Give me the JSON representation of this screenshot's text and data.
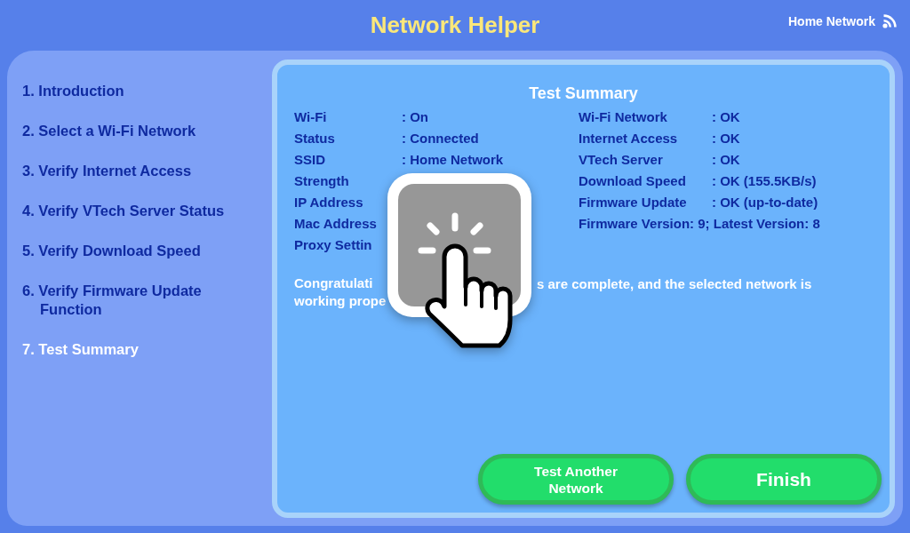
{
  "header": {
    "title": "Network Helper",
    "network_name": "Home Network"
  },
  "steps": [
    {
      "label": "1. Introduction",
      "selected": false
    },
    {
      "label": "2. Select a Wi-Fi Network",
      "selected": false
    },
    {
      "label": "3. Verify Internet Access",
      "selected": false
    },
    {
      "label": "4. Verify VTech Server Status",
      "selected": false
    },
    {
      "label": "5. Verify Download Speed",
      "selected": false
    },
    {
      "label": "6. Verify Firmware Update Function",
      "selected": false
    },
    {
      "label": "7. Test Summary",
      "selected": true
    }
  ],
  "summary": {
    "title": "Test Summary",
    "left_rows": [
      {
        "label": "Wi-Fi",
        "value": ": On"
      },
      {
        "label": "Status",
        "value": ": Connected"
      },
      {
        "label": "SSID",
        "value": ": Home Network"
      },
      {
        "label": "Strength"
      },
      {
        "label": "IP Address"
      },
      {
        "label": "Mac Address"
      },
      {
        "label": "Proxy Settin"
      }
    ],
    "right_rows": [
      {
        "label": "Wi-Fi Network",
        "value": ": OK"
      },
      {
        "label": "Internet Access",
        "value": ": OK"
      },
      {
        "label": "VTech Server",
        "value": ": OK"
      },
      {
        "label": "Download Speed",
        "value": ": OK (155.5KB/s)"
      },
      {
        "label": "Firmware Update",
        "value": ": OK (up-to-date)"
      }
    ],
    "firmware_note": "Firmware Version: 9; Latest Version: 8",
    "message_lines": [
      {
        "before": "Congratulati",
        "after": "s are complete, and the selected network is"
      },
      {
        "before": "working prope"
      }
    ]
  },
  "buttons": [
    {
      "label": "Test Another Network",
      "kind": "secondary"
    },
    {
      "label": "Finish",
      "kind": "primary"
    }
  ]
}
